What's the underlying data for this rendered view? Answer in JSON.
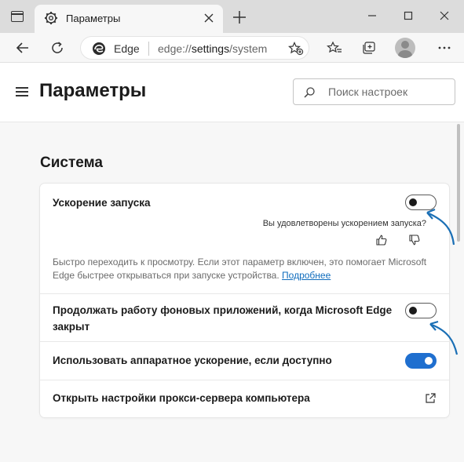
{
  "browser": {
    "tab_title": "Параметры",
    "site_name": "Edge",
    "url_prefix": "edge://",
    "url_path": "settings",
    "url_suffix": "/system"
  },
  "header": {
    "title": "Параметры",
    "search_placeholder": "Поиск настроек"
  },
  "section": {
    "title": "Система"
  },
  "settings": {
    "startup_boost": {
      "label": "Ускорение запуска",
      "enabled": false,
      "feedback_question": "Вы удовлетворены ускорением запуска?",
      "description": "Быстро переходить к просмотру. Если этот параметр включен, это помогает Microsoft Edge быстрее открываться при запуске устройства.",
      "learn_more": "Подробнее"
    },
    "background_apps": {
      "label_line1": "Продолжать работу фоновых приложений, когда Microsoft Edge",
      "label_line2": "закрыт",
      "enabled": false
    },
    "hardware_accel": {
      "label": "Использовать аппаратное ускорение, если доступно",
      "enabled": true
    },
    "proxy": {
      "label": "Открыть настройки прокси-сервера компьютера"
    }
  },
  "colors": {
    "accent": "#1f6fcf",
    "annotation_arrow": "#1a6fb5",
    "link": "#0f6cbd"
  },
  "icons": [
    "tab-actions-icon",
    "gear-icon",
    "close-icon",
    "plus-icon",
    "minimize-icon",
    "maximize-icon",
    "back-icon",
    "refresh-icon",
    "edge-logo-icon",
    "add-favorite-icon",
    "favorites-icon",
    "collections-icon",
    "more-icon",
    "menu-icon",
    "search-icon",
    "thumbs-up-icon",
    "thumbs-down-icon",
    "external-link-icon",
    "arrow-annotation-icon"
  ]
}
